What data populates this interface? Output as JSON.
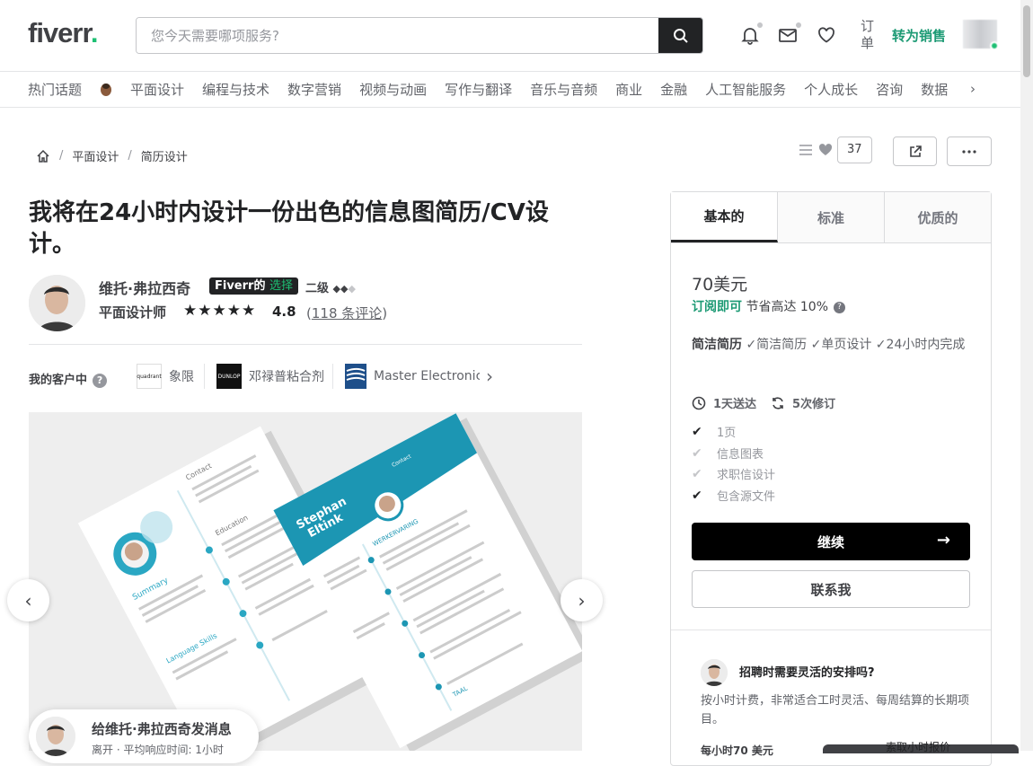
{
  "header": {
    "logo": "fiverr",
    "logo_dot": ".",
    "search_placeholder": "您今天需要哪项服务?",
    "orders": "订单",
    "become_seller": "转为销售"
  },
  "categories": [
    "热门话题",
    "平面设计",
    "编程与技术",
    "数字营销",
    "视频与动画",
    "写作与翻译",
    "音乐与音频",
    "商业",
    "金融",
    "人工智能服务",
    "个人成长",
    "咨询",
    "数据"
  ],
  "categories_more": "›",
  "breadcrumb": [
    "平面设计",
    "简历设计"
  ],
  "breadcrumb_sep": "/",
  "likes_count": "37",
  "gig": {
    "title": "我将在24小时内设计一份出色的信息图简历/CV设计。",
    "seller_name": "维托·弗拉西奇",
    "choice_1": "Fiverr的",
    "choice_2": "选择",
    "level": "二级",
    "level_diamonds_filled": "◆◆",
    "level_diamond_empty": "◆",
    "role": "平面设计师",
    "stars": "★★★★★",
    "rating": "4.8",
    "reviews_open": "(",
    "reviews": "118 条评论",
    "reviews_close": ")"
  },
  "clients": {
    "label": "我的客户中",
    "help": "?",
    "items": [
      {
        "name": "象限",
        "logo_text": "quadrant"
      },
      {
        "name": "邓禄普粘合剂",
        "logo_text": "DUNLOP"
      },
      {
        "name": "Master Electronic",
        "logo_text": ""
      }
    ],
    "more": "›"
  },
  "gallery": {
    "prev": "‹",
    "next": "›",
    "resume_name_1": "Stephan",
    "resume_name_2": "Eltink",
    "resume_sections": [
      "Education",
      "Summary",
      "Contact",
      "Language Skills",
      "WERKERVARING",
      "TAAL"
    ]
  },
  "message": {
    "title": "给维托·弗拉西奇发消息",
    "status": "离开 · 平均响应时间: 1小时"
  },
  "package": {
    "tabs": [
      "基本的",
      "标准",
      "优质的"
    ],
    "price": "70美元",
    "subscribe": "订阅即可",
    "save": "节省高达 10%",
    "save_help": "?",
    "desc_bold": "简洁简历",
    "desc": " ✓简洁简历 ✓单页设计 ✓24小时内完成",
    "delivery": "1天送达",
    "revisions": "5次修订",
    "features": [
      {
        "label": "1页",
        "included": true
      },
      {
        "label": "信息图表",
        "included": false
      },
      {
        "label": "求职信设计",
        "included": false
      },
      {
        "label": "包含源文件",
        "included": true
      }
    ],
    "check": "✔",
    "continue": "继续",
    "continue_arrow": "→",
    "contact": "联系我",
    "hire_title": "招聘时需要灵活的安排吗?",
    "hire_desc": "按小时计费，非常适合工时灵活、每周结算的长期项目。",
    "hire_more": "每小时70 美元"
  },
  "bottom_bar": "索取小时报价",
  "colors": {
    "accent": "#1dbf73",
    "link": "#1c9a74",
    "text": "#404145"
  }
}
